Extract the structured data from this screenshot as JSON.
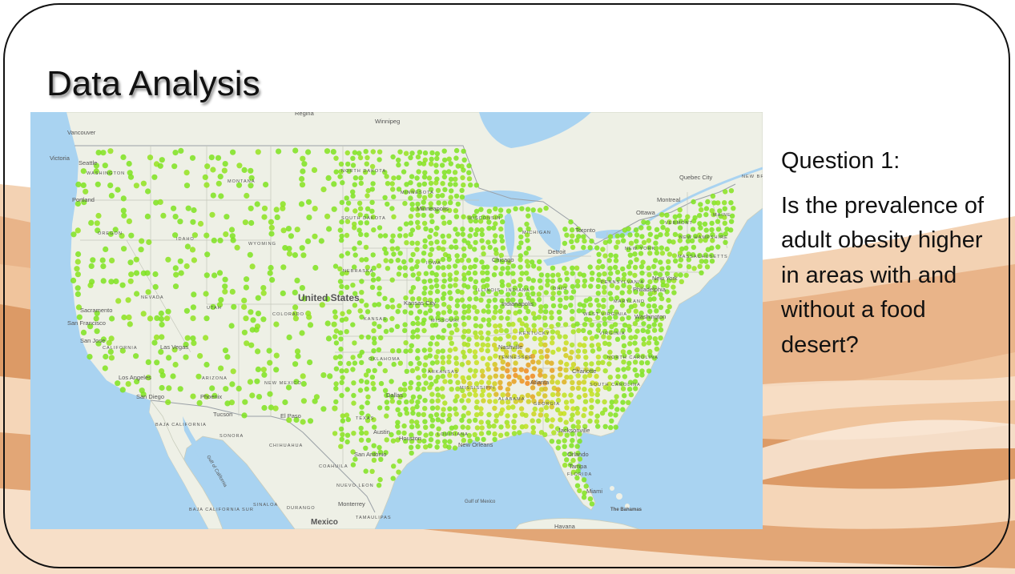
{
  "slide": {
    "title": "Data Analysis",
    "question_heading": "Question 1:",
    "question_text": "Is the prevalence of adult obesity higher in areas with and without a food desert?"
  },
  "map": {
    "country_label": "United States",
    "neighbor_label": "Mexico",
    "cities": [
      {
        "name": "Vancouver"
      },
      {
        "name": "Victoria"
      },
      {
        "name": "Seattle"
      },
      {
        "name": "Portland"
      },
      {
        "name": "Sacramento"
      },
      {
        "name": "San Francisco"
      },
      {
        "name": "San Jose"
      },
      {
        "name": "Las Vegas"
      },
      {
        "name": "Los Angeles"
      },
      {
        "name": "San Diego"
      },
      {
        "name": "Phoenix"
      },
      {
        "name": "Tucson"
      },
      {
        "name": "El Paso"
      },
      {
        "name": "Dallas"
      },
      {
        "name": "Austin"
      },
      {
        "name": "Houston"
      },
      {
        "name": "San Antonio"
      },
      {
        "name": "New Orleans"
      },
      {
        "name": "Kansas City"
      },
      {
        "name": "Chicago"
      },
      {
        "name": "Minneapolis"
      },
      {
        "name": "Winnipeg"
      },
      {
        "name": "Regina"
      },
      {
        "name": "Detroit"
      },
      {
        "name": "Toronto"
      },
      {
        "name": "Ottawa"
      },
      {
        "name": "Montreal"
      },
      {
        "name": "Quebec City"
      },
      {
        "name": "Indianapolis"
      },
      {
        "name": "Nashville"
      },
      {
        "name": "Atlanta"
      },
      {
        "name": "Charlotte"
      },
      {
        "name": "Washington"
      },
      {
        "name": "Philadelphia"
      },
      {
        "name": "New York"
      },
      {
        "name": "Jacksonville"
      },
      {
        "name": "Orlando"
      },
      {
        "name": "Tampa"
      },
      {
        "name": "Miami"
      },
      {
        "name": "Monterrey"
      },
      {
        "name": "Havana"
      },
      {
        "name": "The Bahamas"
      },
      {
        "name": "Gulf of Mexico"
      },
      {
        "name": "Gulf of California"
      }
    ],
    "regions": [
      {
        "name": "WASHINGTON"
      },
      {
        "name": "OREGON"
      },
      {
        "name": "IDAHO"
      },
      {
        "name": "MONTANA"
      },
      {
        "name": "NEVADA"
      },
      {
        "name": "UTAH"
      },
      {
        "name": "CALIFORNIA"
      },
      {
        "name": "ARIZONA"
      },
      {
        "name": "WYOMING"
      },
      {
        "name": "COLORADO"
      },
      {
        "name": "NEW MEXICO"
      },
      {
        "name": "NORTH DAKOTA"
      },
      {
        "name": "SOUTH DAKOTA"
      },
      {
        "name": "NEBRASKA"
      },
      {
        "name": "KANSAS"
      },
      {
        "name": "OKLAHOMA"
      },
      {
        "name": "TEXAS"
      },
      {
        "name": "MINNESOTA"
      },
      {
        "name": "IOWA"
      },
      {
        "name": "MISSOURI"
      },
      {
        "name": "ARKANSAS"
      },
      {
        "name": "LOUISIANA"
      },
      {
        "name": "WISCONSIN"
      },
      {
        "name": "ILLINOIS"
      },
      {
        "name": "MICHIGAN"
      },
      {
        "name": "INDIANA"
      },
      {
        "name": "OHIO"
      },
      {
        "name": "KENTUCKY"
      },
      {
        "name": "TENNESSEE"
      },
      {
        "name": "MISSISSIPPI"
      },
      {
        "name": "ALABAMA"
      },
      {
        "name": "GEORGIA"
      },
      {
        "name": "FLORIDA"
      },
      {
        "name": "SOUTH CAROLINA"
      },
      {
        "name": "NORTH CAROLINA"
      },
      {
        "name": "VIRGINIA"
      },
      {
        "name": "WEST VIRGINIA"
      },
      {
        "name": "PENNSYLVANIA"
      },
      {
        "name": "NEW YORK"
      },
      {
        "name": "MARYLAND"
      },
      {
        "name": "VERMONT"
      },
      {
        "name": "NEW HAMPSHIRE"
      },
      {
        "name": "MASSACHUSETTS"
      },
      {
        "name": "MAINE"
      },
      {
        "name": "BAJA CALIFORNIA"
      },
      {
        "name": "BAJA CALIFORNIA SUR"
      },
      {
        "name": "SONORA"
      },
      {
        "name": "CHIHUAHUA"
      },
      {
        "name": "COAHUILA"
      },
      {
        "name": "NUEVO LEON"
      },
      {
        "name": "SINALOA"
      },
      {
        "name": "DURANGO"
      },
      {
        "name": "TAMAULIPAS"
      },
      {
        "name": "NEW BRUNSWICK"
      }
    ],
    "colors": {
      "water": "#a9d3f1",
      "land": "#eef0e6",
      "us_land": "#ecefe3",
      "marker_low": "#7ee31f",
      "marker_mid": "#c6e21c",
      "marker_high": "#f08a1c"
    }
  }
}
